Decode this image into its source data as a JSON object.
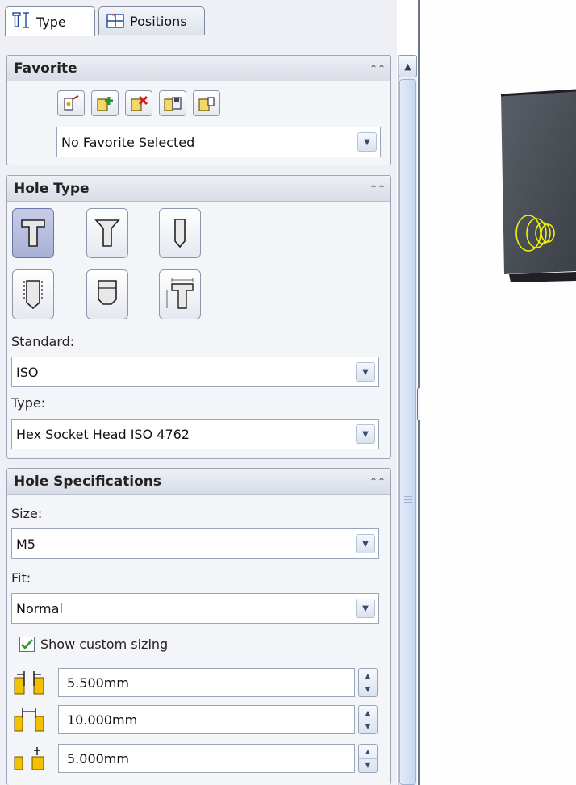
{
  "tabs": [
    {
      "label": "Type",
      "icon": "hole-type-icon",
      "active": true
    },
    {
      "label": "Positions",
      "icon": "positions-icon",
      "active": false
    }
  ],
  "favorite": {
    "title": "Favorite",
    "buttons": [
      "update-favorite-icon",
      "add-favorite-icon",
      "delete-favorite-icon",
      "save-favorite-icon",
      "load-favorite-icon"
    ],
    "selected": "No Favorite Selected"
  },
  "hole_type": {
    "title": "Hole Type",
    "buttons": [
      "counterbore-icon",
      "countersink-icon",
      "hole-icon",
      "straight-tap-icon",
      "tapered-tap-icon",
      "legacy-hole-icon"
    ],
    "selected_index": 0,
    "standard_label": "Standard:",
    "standard_value": "ISO",
    "type_label": "Type:",
    "type_value": "Hex Socket Head ISO 4762"
  },
  "hole_specifications": {
    "title": "Hole Specifications",
    "size_label": "Size:",
    "size_value": "M5",
    "fit_label": "Fit:",
    "fit_value": "Normal",
    "custom_sizing_label": "Show custom sizing",
    "custom_sizing_checked": true,
    "dimensions": [
      {
        "icon": "through-hole-diameter-icon",
        "value": "5.500mm"
      },
      {
        "icon": "counterbore-diameter-icon",
        "value": "10.000mm"
      },
      {
        "icon": "counterbore-depth-icon",
        "value": "5.000mm"
      }
    ]
  },
  "colors": {
    "panel_bg": "#eef0f5",
    "selection": "#a8b0d6",
    "check_green": "#2a9a2a",
    "dim_icon_yellow": "#f2c200",
    "model_face": "#4a4f57",
    "hole_highlight": "#f0f000"
  }
}
